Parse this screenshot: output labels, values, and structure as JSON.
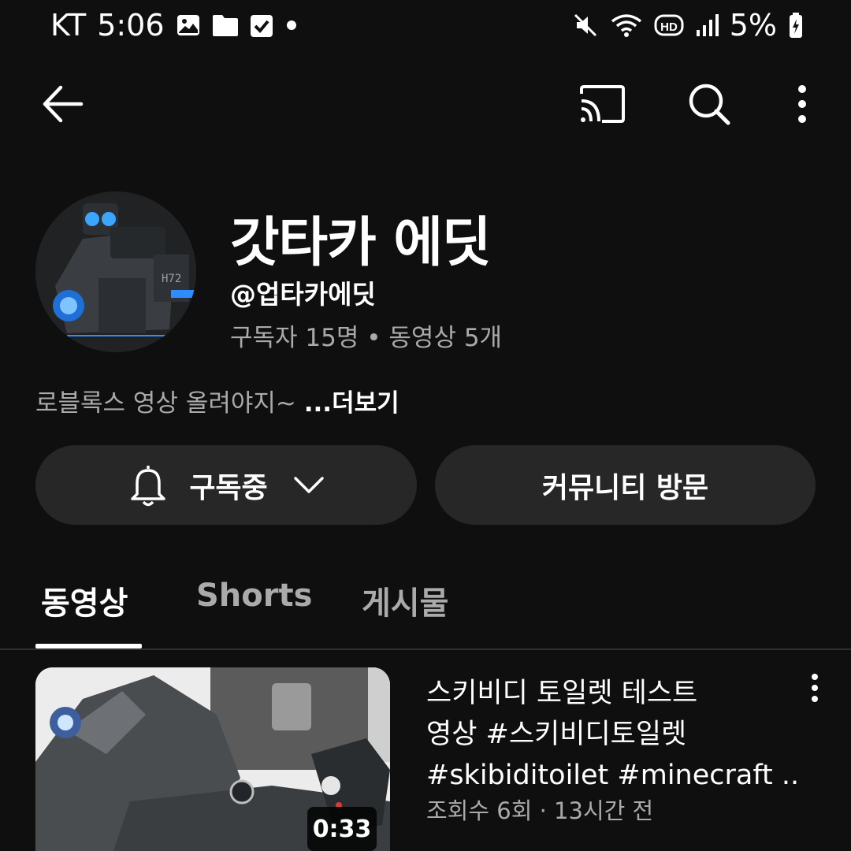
{
  "status_bar": {
    "carrier": "KT",
    "time": "5:06",
    "battery": "5%",
    "icons": [
      "image-icon",
      "folder-icon",
      "checkbox-icon",
      "dot-icon",
      "mute-icon",
      "wifi-icon",
      "hd-icon",
      "signal-icon",
      "battery-icon"
    ]
  },
  "top_bar": {
    "icons": [
      "back-arrow-icon",
      "cast-icon",
      "search-icon",
      "more-vertical-icon"
    ]
  },
  "channel": {
    "name": "갓타카 에딧",
    "handle": "@업타카에딧",
    "subscribers": "구독자 15명",
    "separator": "•",
    "video_count": "동영상 5개",
    "description": "로블록스 영상 올려야지~",
    "more_label": "...더보기"
  },
  "actions": {
    "subscribe_label": "구독중",
    "community_label": "커뮤니티 방문"
  },
  "tabs": [
    {
      "label": "동영상",
      "active": true
    },
    {
      "label": "Shorts",
      "active": false
    },
    {
      "label": "게시물",
      "active": false
    }
  ],
  "video": {
    "title_line1": "스키비디 토일렛 테스트",
    "title_line2": "영상 #스키비디토일렛",
    "title_line3": "#skibiditoilet #minecraft ...",
    "meta": "조회수 6회 · 13시간 전",
    "duration": "0:33"
  },
  "colors": {
    "background": "#0f0f0f",
    "pill": "#272727",
    "secondary_text": "#aaaaaa",
    "accent_blue": "#2f8cff"
  }
}
